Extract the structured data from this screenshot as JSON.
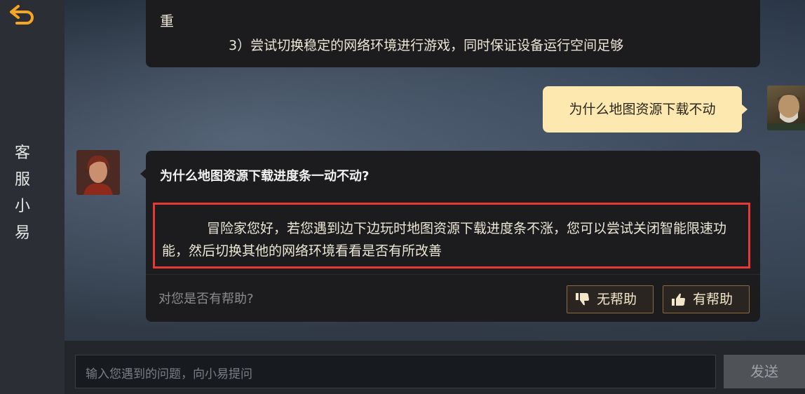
{
  "sidebar": {
    "title_chars": [
      "客",
      "服",
      "小",
      "易"
    ]
  },
  "chat": {
    "prev_bot": {
      "line1": "重",
      "line2": "3）尝试切换稳定的网络环境进行游戏，同时保证设备运行空间足够"
    },
    "user_message": "为什么地图资源下载不动",
    "bot_reply": {
      "question_title": "为什么地图资源下载进度条一动不动?",
      "answer": "冒险家您好，若您遇到边下边玩时地图资源下载进度条不涨，您可以尝试关闭智能限速功能，然后切换其他的网络环境看看是否有所改善",
      "helpful_prompt": "对您是否有帮助?",
      "not_helpful_label": "无帮助",
      "helpful_label": "有帮助"
    }
  },
  "input": {
    "placeholder": "输入您遇到的问题，向小易提问",
    "send_label": "发送"
  },
  "colors": {
    "accent_gold": "#f5a623",
    "highlight_red": "#e53935",
    "user_bubble": "#fde9b0"
  },
  "icons": {
    "back": "back-arrow-icon",
    "thumbs_down": "thumbs-down-icon",
    "thumbs_up": "thumbs-up-icon"
  }
}
